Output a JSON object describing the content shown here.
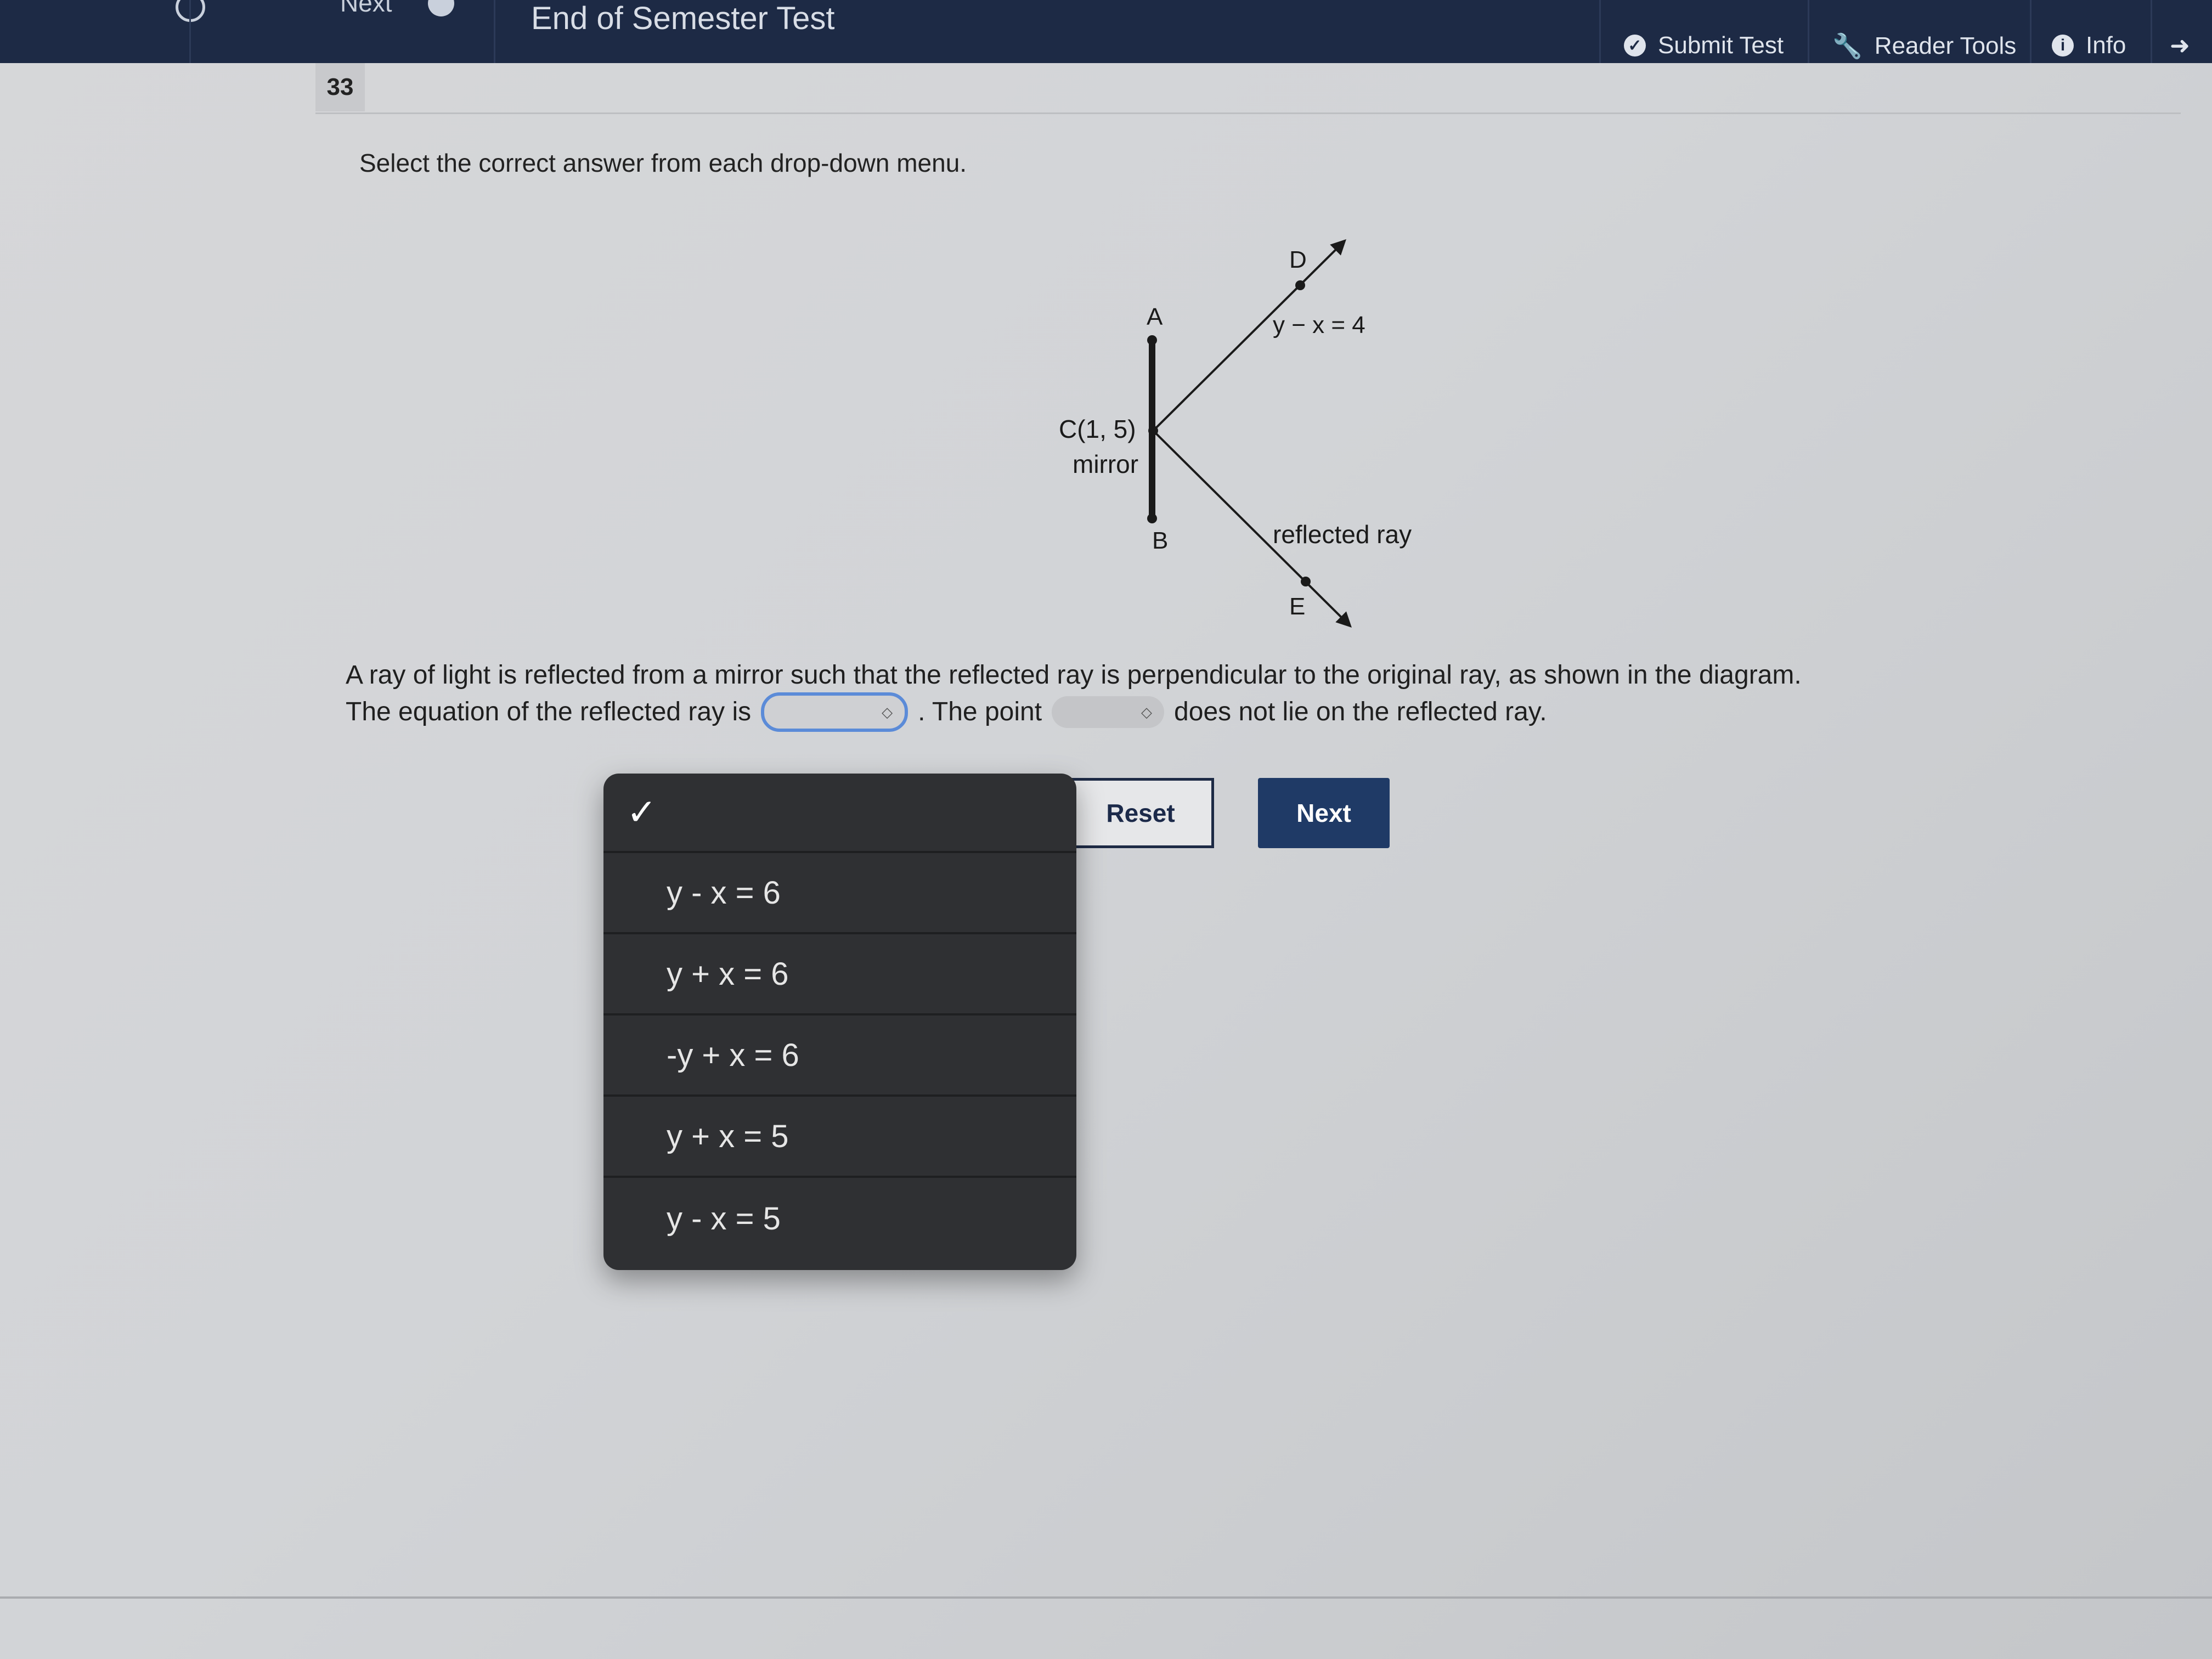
{
  "header": {
    "title": "End of Semester Test",
    "next_fragment": "Next",
    "tools": [
      {
        "label": "Submit Test",
        "icon": "check-circle-icon"
      },
      {
        "label": "Reader Tools",
        "icon": "wrench-icon"
      },
      {
        "label": "Info",
        "icon": "info-icon"
      }
    ]
  },
  "question": {
    "number": "33",
    "instruction": "Select the correct answer from each drop-down menu.",
    "text_line1": "A ray of light is reflected from a mirror such that the reflected ray is perpendicular to the original ray, as shown in the diagram.",
    "text_line2_a": "The equation of the reflected ray is",
    "text_line2_b": ". The point",
    "text_line2_c": "does not lie on the reflected ray."
  },
  "diagram": {
    "label_D": "D",
    "label_A": "A",
    "label_eq": "y − x = 4",
    "label_C": "C(1, 5)",
    "label_mirror": "mirror",
    "label_B": "B",
    "label_reflected": "reflected ray",
    "label_E": "E"
  },
  "dropdown": {
    "selected_mark": "✓",
    "options": [
      "y - x = 6",
      "y + x = 6",
      "-y + x = 6",
      "y + x = 5",
      "y - x = 5"
    ]
  },
  "buttons": {
    "reset": "Reset",
    "next": "Next"
  }
}
